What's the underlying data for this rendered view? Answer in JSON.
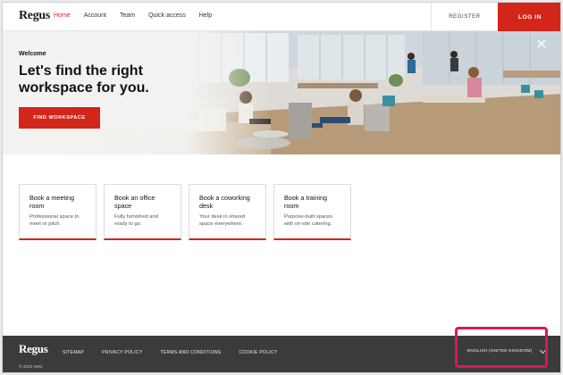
{
  "header": {
    "logo": "Regus",
    "nav": [
      "Home",
      "Account",
      "Team",
      "Quick access",
      "Help"
    ],
    "active_nav": "Home",
    "register": "REGISTER",
    "login": "LOG IN"
  },
  "hero": {
    "welcome": "Welcome",
    "headline": "Let's find the right workspace for you.",
    "cta": "FIND WORKSPACE",
    "close_icon": "close-icon"
  },
  "cards": [
    {
      "title": "Book a meeting room",
      "desc": "Professional space to meet or pitch."
    },
    {
      "title": "Book an office space",
      "desc": "Fully furnished and ready to go."
    },
    {
      "title": "Book a coworking desk",
      "desc": "Your desk in shared space everywhere."
    },
    {
      "title": "Book a training room",
      "desc": "Purpose-built spaces with on-site catering."
    }
  ],
  "footer": {
    "logo": "Regus",
    "links": [
      "SITEMAP",
      "PRIVACY POLICY",
      "TERMS AND CONDITIONS",
      "COOKIE POLICY"
    ],
    "copyright": "© 2021 IWG",
    "language": "ENGLISH (UNITED KINGDOM)"
  },
  "colors": {
    "brand": "#d2261b",
    "footer_bg": "#3b3b3b",
    "highlight": "#d61c4e"
  }
}
